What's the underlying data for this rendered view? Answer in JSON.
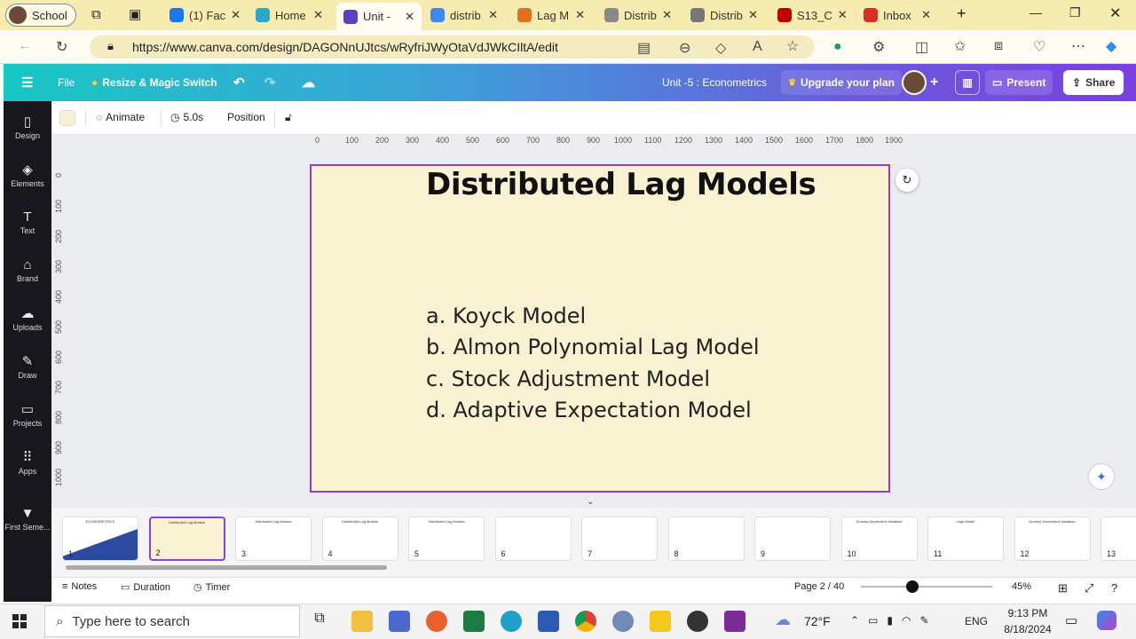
{
  "browser": {
    "profile": "School",
    "tabs": [
      {
        "label": "(1) Fac",
        "color": "#1877f2"
      },
      {
        "label": "Home",
        "color": "#2aa7c9"
      },
      {
        "label": "Unit -",
        "color": "#5a3fc0"
      },
      {
        "label": "distrib",
        "color": "#4285f4"
      },
      {
        "label": "Lag M",
        "color": "#e07020"
      },
      {
        "label": "Distrib",
        "color": "#888888"
      },
      {
        "label": "Distrib",
        "color": "#777777"
      },
      {
        "label": "S13_C",
        "color": "#c00000"
      },
      {
        "label": "Inbox",
        "color": "#d93025"
      }
    ],
    "url": "https://www.canva.com/design/DAGONnUJtcs/wRyfriJWyOtaVdJWkCIltA/edit"
  },
  "header": {
    "menu_icon": "hamburger-icon",
    "file": "File",
    "resize": "Resize & Magic Switch",
    "title": "Unit -5 : Econometrics",
    "upgrade": "Upgrade your plan",
    "plus": "+",
    "present": "Present",
    "share": "Share"
  },
  "sidebar": [
    {
      "label": "Design",
      "icon": "▯"
    },
    {
      "label": "Elements",
      "icon": "◈"
    },
    {
      "label": "Text",
      "icon": "T"
    },
    {
      "label": "Brand",
      "icon": "⌂"
    },
    {
      "label": "Uploads",
      "icon": "☁"
    },
    {
      "label": "Draw",
      "icon": "✎"
    },
    {
      "label": "Projects",
      "icon": "▭"
    },
    {
      "label": "Apps",
      "icon": "⠿"
    },
    {
      "label": "First Seme...",
      "icon": "▼"
    }
  ],
  "toolbar": {
    "animate": "Animate",
    "duration": "5.0s",
    "position": "Position"
  },
  "ruler": {
    "h": [
      "0",
      "100",
      "200",
      "300",
      "400",
      "500",
      "600",
      "700",
      "800",
      "900",
      "1000",
      "1100",
      "1200",
      "1300",
      "1400",
      "1500",
      "1600",
      "1700",
      "1800",
      "1900"
    ],
    "v": [
      "0",
      "100",
      "200",
      "300",
      "400",
      "500",
      "600",
      "700",
      "800",
      "900",
      "1000"
    ]
  },
  "slide": {
    "title": "Distributed Lag Models",
    "items": [
      "a. Koyck Model",
      "b. Almon Polynomial Lag Model",
      "c. Stock Adjustment Model",
      "d. Adaptive Expectation Model"
    ],
    "bg": "#f8f1d2"
  },
  "pages": [
    {
      "n": "1",
      "t": "ECONOMETRICS"
    },
    {
      "n": "2",
      "t": "Distributed Lag Models"
    },
    {
      "n": "3",
      "t": "Distributed Lag Models"
    },
    {
      "n": "4",
      "t": "Distributed Lag Models"
    },
    {
      "n": "5",
      "t": "Distributed Lag Models"
    },
    {
      "n": "6",
      "t": ""
    },
    {
      "n": "7",
      "t": ""
    },
    {
      "n": "8",
      "t": ""
    },
    {
      "n": "9",
      "t": ""
    },
    {
      "n": "10",
      "t": "Dummy Dependent Variables"
    },
    {
      "n": "11",
      "t": "Logit Model"
    },
    {
      "n": "12",
      "t": "Dummy Dependent Variables"
    },
    {
      "n": "13",
      "t": ""
    }
  ],
  "footer": {
    "notes": "Notes",
    "duration": "Duration",
    "timer": "Timer",
    "page": "Page 2 / 40",
    "zoom": "45%"
  },
  "taskbar": {
    "search": "Type here to search",
    "weather": "72°F",
    "lang": "ENG",
    "time": "9:13 PM",
    "date": "8/18/2024"
  }
}
